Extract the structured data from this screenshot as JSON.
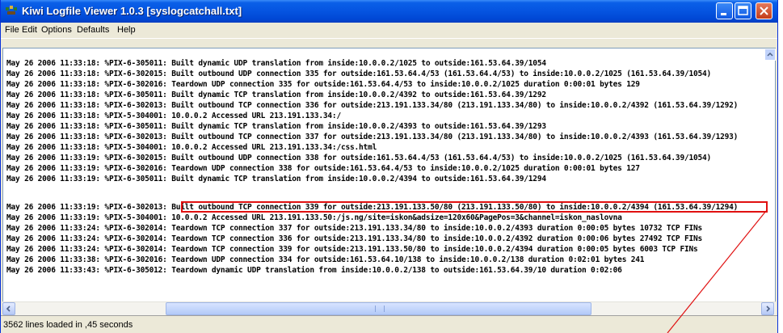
{
  "window": {
    "title": "Kiwi Logfile Viewer 1.0.3 [syslogcatchall.txt]"
  },
  "menu": {
    "items": [
      "File",
      "Edit",
      "Options",
      "Defaults",
      "Help"
    ]
  },
  "log": {
    "lines": [
      "May 26 2006 11:33:18: %PIX-6-305011: Built dynamic UDP translation from inside:10.0.0.2/1025 to outside:161.53.64.39/1054",
      "May 26 2006 11:33:18: %PIX-6-302015: Built outbound UDP connection 335 for outside:161.53.64.4/53 (161.53.64.4/53) to inside:10.0.0.2/1025 (161.53.64.39/1054)",
      "May 26 2006 11:33:18: %PIX-6-302016: Teardown UDP connection 335 for outside:161.53.64.4/53 to inside:10.0.0.2/1025 duration 0:00:01 bytes 129",
      "May 26 2006 11:33:18: %PIX-6-305011: Built dynamic TCP translation from inside:10.0.0.2/4392 to outside:161.53.64.39/1292",
      "May 26 2006 11:33:18: %PIX-6-302013: Built outbound TCP connection 336 for outside:213.191.133.34/80 (213.191.133.34/80) to inside:10.0.0.2/4392 (161.53.64.39/1292)",
      "May 26 2006 11:33:18: %PIX-5-304001: 10.0.0.2 Accessed URL 213.191.133.34:/",
      "May 26 2006 11:33:18: %PIX-6-305011: Built dynamic TCP translation from inside:10.0.0.2/4393 to outside:161.53.64.39/1293",
      "May 26 2006 11:33:18: %PIX-6-302013: Built outbound TCP connection 337 for outside:213.191.133.34/80 (213.191.133.34/80) to inside:10.0.0.2/4393 (161.53.64.39/1293)",
      "May 26 2006 11:33:18: %PIX-5-304001: 10.0.0.2 Accessed URL 213.191.133.34:/css.html",
      "May 26 2006 11:33:19: %PIX-6-302015: Built outbound UDP connection 338 for outside:161.53.64.4/53 (161.53.64.4/53) to inside:10.0.0.2/1025 (161.53.64.39/1054)",
      "May 26 2006 11:33:19: %PIX-6-302016: Teardown UDP connection 338 for outside:161.53.64.4/53 to inside:10.0.0.2/1025 duration 0:00:01 bytes 127",
      "May 26 2006 11:33:19: %PIX-6-305011: Built dynamic TCP translation from inside:10.0.0.2/4394 to outside:161.53.64.39/1294",
      "May 26 2006 11:33:19: %PIX-6-302013: Built outbound TCP connection 339 for outside:213.191.133.50/80 (213.191.133.50/80) to inside:10.0.0.2/4394 (161.53.64.39/1294)",
      "May 26 2006 11:33:19: %PIX-5-304001: 10.0.0.2 Accessed URL 213.191.133.50:/js.ng/site=iskon&adsize=120x60&PagePos=3&channel=iskon_naslovna",
      "May 26 2006 11:33:24: %PIX-6-302014: Teardown TCP connection 337 for outside:213.191.133.34/80 to inside:10.0.0.2/4393 duration 0:00:05 bytes 10732 TCP FINs",
      "May 26 2006 11:33:24: %PIX-6-302014: Teardown TCP connection 336 for outside:213.191.133.34/80 to inside:10.0.0.2/4392 duration 0:00:06 bytes 27492 TCP FINs",
      "May 26 2006 11:33:24: %PIX-6-302014: Teardown TCP connection 339 for outside:213.191.133.50/80 to inside:10.0.0.2/4394 duration 0:00:05 bytes 6003 TCP FINs",
      "May 26 2006 11:33:38: %PIX-6-302016: Teardown UDP connection 334 for outside:161.53.64.10/138 to inside:10.0.0.2/138 duration 0:02:01 bytes 241",
      "May 26 2006 11:33:43: %PIX-6-305012: Teardown dynamic UDP translation from inside:10.0.0.2/138 to outside:161.53.64.39/10 duration 0:02:06"
    ],
    "highlighted_line": "Built outbound TCP connection 339 for outside:213.191.133.50/80 (213.191.133.50/80) to inside:10.0.0.2/4394 (161.53.64.39/1294)"
  },
  "status": {
    "text": "3562 lines loaded in ,45 seconds"
  },
  "colors": {
    "titlebar": "#0554e0",
    "highlight": "#e01010"
  },
  "icons": {
    "app": "kiwi-app-icon",
    "minimize": "minimize-icon",
    "maximize": "maximize-icon",
    "close": "close-icon"
  }
}
